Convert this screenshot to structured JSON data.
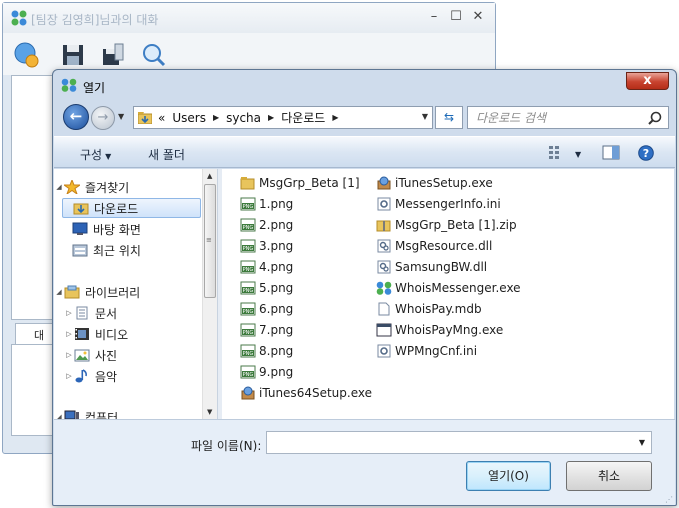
{
  "background_window": {
    "title": "[팀장 김영희]님과의 대화",
    "tab_label": "대"
  },
  "dialog": {
    "title": "열기",
    "close_label": "x",
    "nav": {
      "back_label": "←",
      "forward_label": "→"
    },
    "address": {
      "overflow": "«",
      "crumbs": [
        "Users",
        "sycha",
        "다운로드"
      ]
    },
    "search": {
      "placeholder": "다운로드 검색"
    },
    "commands": {
      "organize": "구성",
      "new_folder": "새 폴더"
    },
    "navigation": {
      "favorites_header": "즐겨찾기",
      "favorites": [
        "다운로드",
        "바탕 화면",
        "최근 위치"
      ],
      "libraries_header": "라이브러리",
      "libraries": [
        "문서",
        "비디오",
        "사진",
        "음악"
      ],
      "computer_header": "컴퓨터"
    },
    "files_col1": [
      {
        "name": "MsgGrp_Beta [1]",
        "icon": "folder-icon"
      },
      {
        "name": "1.png",
        "icon": "png-file-icon"
      },
      {
        "name": "2.png",
        "icon": "png-file-icon"
      },
      {
        "name": "3.png",
        "icon": "png-file-icon"
      },
      {
        "name": "4.png",
        "icon": "png-file-icon"
      },
      {
        "name": "5.png",
        "icon": "png-file-icon"
      },
      {
        "name": "6.png",
        "icon": "png-file-icon"
      },
      {
        "name": "7.png",
        "icon": "png-file-icon"
      },
      {
        "name": "8.png",
        "icon": "png-file-icon"
      },
      {
        "name": "9.png",
        "icon": "png-file-icon"
      },
      {
        "name": "iTunes64Setup.exe",
        "icon": "installer-icon"
      }
    ],
    "files_col2": [
      {
        "name": "iTunesSetup.exe",
        "icon": "installer-icon"
      },
      {
        "name": "MessengerInfo.ini",
        "icon": "settings-file-icon"
      },
      {
        "name": "MsgGrp_Beta [1].zip",
        "icon": "zip-file-icon"
      },
      {
        "name": "MsgResource.dll",
        "icon": "dll-file-icon"
      },
      {
        "name": "SamsungBW.dll",
        "icon": "dll-file-icon"
      },
      {
        "name": "WhoisMessenger.exe",
        "icon": "messenger-app-icon"
      },
      {
        "name": "WhoisPay.mdb",
        "icon": "blank-file-icon"
      },
      {
        "name": "WhoisPayMng.exe",
        "icon": "exe-window-icon"
      },
      {
        "name": "WPMngCnf.ini",
        "icon": "settings-file-icon"
      }
    ],
    "filename": {
      "label": "파일 이름(N):",
      "value": ""
    },
    "buttons": {
      "open": "열기(O)",
      "cancel": "취소"
    }
  }
}
